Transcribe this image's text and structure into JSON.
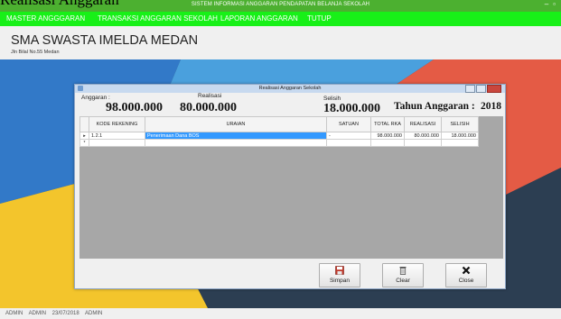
{
  "page_caption": "Realisasi Anggaran",
  "window": {
    "title": "SISTEM INFORMASI ANGGARAN PENDAPATAN BELANJA SEKOLAH"
  },
  "menu": [
    {
      "label": "MASTER ANGGGARAN"
    },
    {
      "label": "TRANSAKSI ANGGARAN SEKOLAH"
    },
    {
      "label": "LAPORAN ANGGARAN"
    },
    {
      "label": "TUTUP"
    }
  ],
  "header": {
    "school": "SMA SWASTA IMELDA MEDAN",
    "address": "Jln Bilal No.55 Medan"
  },
  "dialog": {
    "title": "Realisasi Anggaran Sekolah",
    "anggaran_label": "Anggaran :",
    "anggaran_value": "98.000.000",
    "realisasi_label": "Realisasi",
    "realisasi_value": "80.000.000",
    "selisih_label": "Selisih",
    "selisih_value": "18.000.000",
    "tahun_label": "Tahun Anggaran :",
    "tahun_value": "2018",
    "table": {
      "headers": [
        "KODE REKENING",
        "URAIAN",
        "SATUAN",
        "TOTAL RKA",
        "REALISASI",
        "SELISIH"
      ],
      "rows": [
        {
          "marker": "▸",
          "kode": "1.2.1",
          "uraian": "Penerimaan Dana BOS",
          "satuan": "-",
          "total": "98.000.000",
          "realisasi": "80.000.000",
          "selisih": "18.000.000"
        },
        {
          "marker": "*",
          "kode": "",
          "uraian": "",
          "satuan": "",
          "total": "",
          "realisasi": "",
          "selisih": ""
        }
      ]
    },
    "buttons": {
      "simpan": "Simpan",
      "clear": "Clear",
      "close": "Close"
    }
  },
  "status": {
    "text": "ADMIN    ADMIN    23/07/2018    ADMIN"
  },
  "colors": {
    "titlebar": "#4cb030",
    "menubar": "#18f018",
    "selection": "#3399ff"
  },
  "icons": {
    "simpan": "floppy-disk-icon",
    "clear": "trash-icon",
    "close": "x-icon"
  }
}
